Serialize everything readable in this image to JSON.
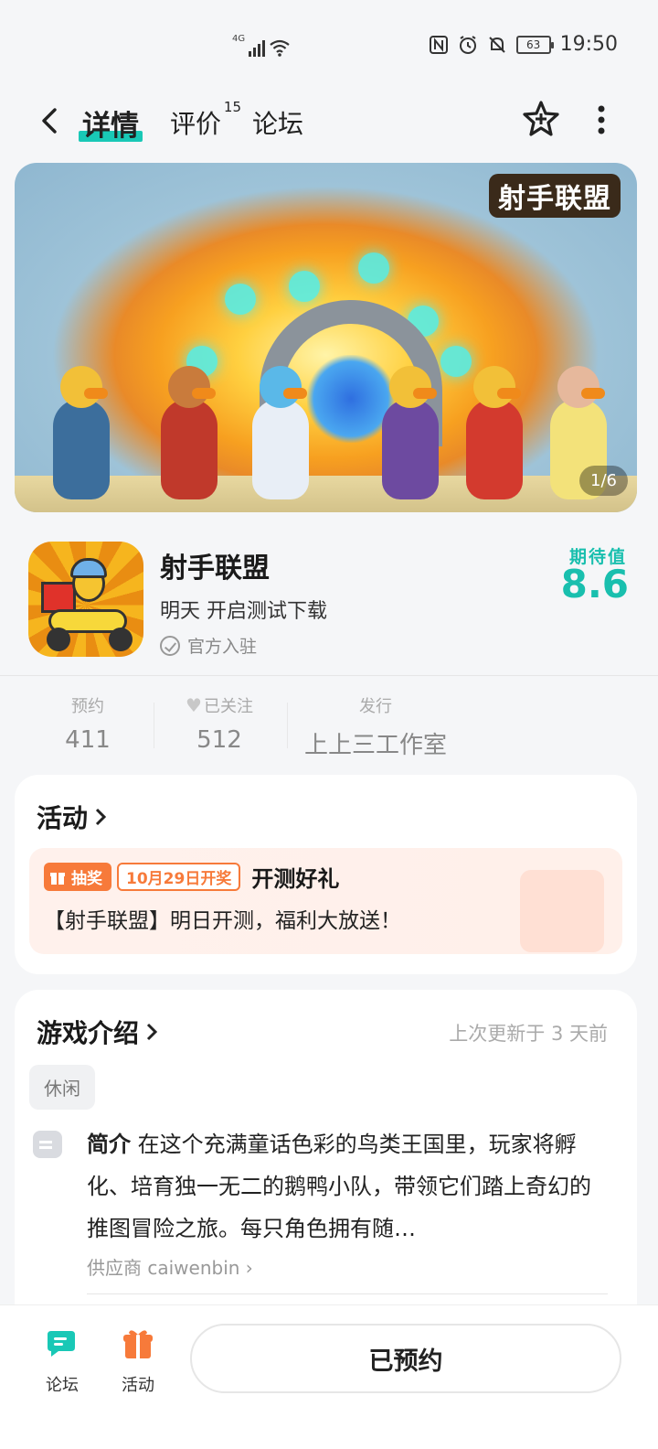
{
  "status_bar": {
    "network": "4G",
    "battery": "63",
    "time": "19:50"
  },
  "nav": {
    "tabs": [
      {
        "label": "详情",
        "active": true
      },
      {
        "label": "评价",
        "badge": "15"
      },
      {
        "label": "论坛"
      }
    ]
  },
  "banner": {
    "logo_text": "射手联盟",
    "counter": "1/6"
  },
  "game": {
    "title": "射手联盟",
    "subtitle": "明天 开启测试下载",
    "official": "官方入驻",
    "expect_label": "期待值",
    "expect_value": "8.6"
  },
  "stats": [
    {
      "label": "预约",
      "value": "411"
    },
    {
      "label": "已关注",
      "value": "512"
    },
    {
      "label": "发行",
      "value": "上上三工作室"
    }
  ],
  "activity": {
    "title": "活动",
    "badge": "抽奖",
    "date_badge": "10月29日开奖",
    "headline": "开测好礼",
    "description": "【射手联盟】明日开测，福利大放送！"
  },
  "intro": {
    "title": "游戏介绍",
    "updated": "上次更新于 3 天前",
    "tag": "休闲",
    "label": "简介",
    "text": " 在这个充满童话色彩的鸟类王国里，玩家将孵化、培育独一无二的鹅鸭小队，带领它们踏上奇幻的推图冒险之旅。每只角色拥有随…",
    "supplier": "供应商 caiwenbin"
  },
  "bottom_bar": {
    "forum_label": "论坛",
    "activity_label": "活动",
    "reserve_button": "已预约"
  },
  "colors": {
    "accent": "#19c8b6",
    "expect": "#19bfae",
    "lottery": "#f77a3a"
  }
}
